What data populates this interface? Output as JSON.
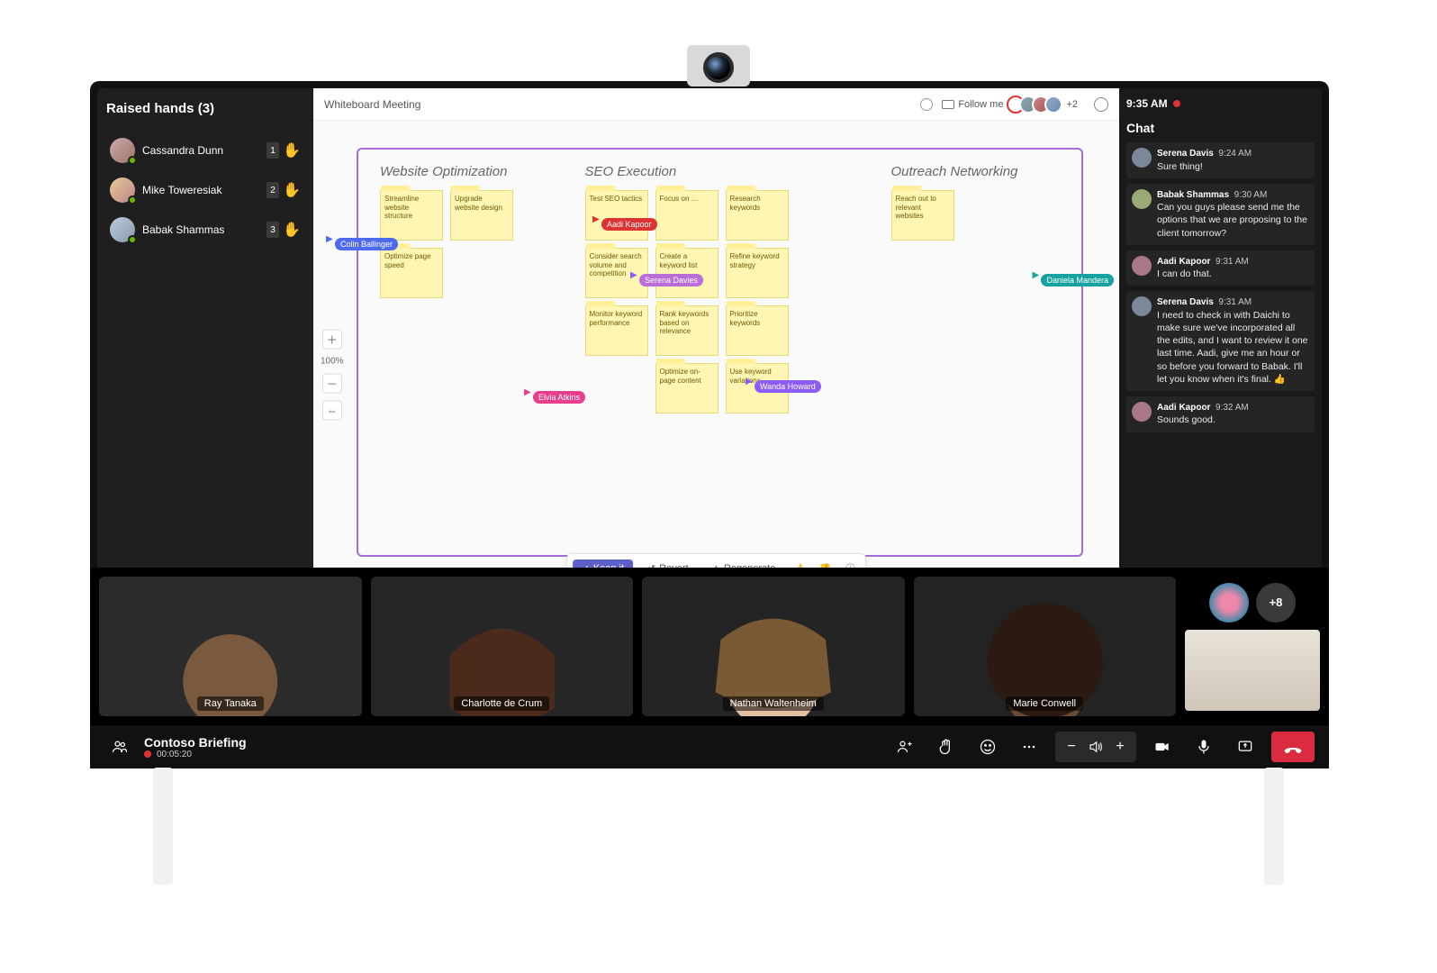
{
  "raisedHands": {
    "title": "Raised hands (3)",
    "items": [
      {
        "name": "Cassandra Dunn",
        "order": "1"
      },
      {
        "name": "Mike Toweresiak",
        "order": "2"
      },
      {
        "name": "Babak Shammas",
        "order": "3"
      }
    ]
  },
  "whiteboard": {
    "title": "Whiteboard Meeting",
    "followLabel": "Follow me",
    "extraCount": "+2",
    "zoom": "100%",
    "columns": [
      {
        "title": "Website Optimization",
        "notes": [
          [
            "Streamline website structure",
            "Upgrade website design"
          ],
          [
            "Optimize page speed",
            ""
          ]
        ]
      },
      {
        "title": "SEO Execution",
        "notes": [
          [
            "Test SEO tactics",
            "Focus on …",
            "Research keywords"
          ],
          [
            "Consider search volume and competition",
            "Create a keyword list",
            "Refine keyword strategy"
          ],
          [
            "Monitor keyword performance",
            "Rank keywords based on relevance",
            "Prioritize keywords"
          ],
          [
            "",
            "Optimize on-page content",
            "Use keyword variations"
          ]
        ]
      },
      {
        "title": "Outreach Networking",
        "notes": [
          [
            "Reach out to relevant websites"
          ]
        ]
      }
    ],
    "cursors": {
      "colin": "Colin Ballinger",
      "aadi": "Aadi Kapoor",
      "serena": "Serena Davies",
      "daniela": "Daniela Mandera",
      "wanda": "Wanda Howard",
      "elvia": "Elvia Atkins"
    },
    "actions": {
      "keep": "Keep it",
      "revert": "Revert",
      "regenerate": "Regenerate"
    }
  },
  "clock": "9:35 AM",
  "chat": {
    "title": "Chat",
    "messages": [
      {
        "name": "Serena Davis",
        "time": "9:24 AM",
        "body": "Sure thing!"
      },
      {
        "name": "Babak Shammas",
        "time": "9:30 AM",
        "body": "Can you guys please send me the options that we are proposing to the client tomorrow?"
      },
      {
        "name": "Aadi Kapoor",
        "time": "9:31 AM",
        "body": "I can do that."
      },
      {
        "name": "Serena Davis",
        "time": "9:31 AM",
        "body": "I need to check in with Daichi to make sure we've incorporated all the edits, and I want to review it one last time. Aadi, give me an hour or so before you forward to Babak. I'll let you know when it's final. 👍"
      },
      {
        "name": "Aadi Kapoor",
        "time": "9:32 AM",
        "body": "Sounds good."
      }
    ]
  },
  "videos": [
    "Ray Tanaka",
    "Charlotte de Crum",
    "Nathan Waltenheim",
    "Marie Conwell"
  ],
  "overflow": "+8",
  "meeting": {
    "title": "Contoso Briefing",
    "elapsed": "00:05:20"
  }
}
